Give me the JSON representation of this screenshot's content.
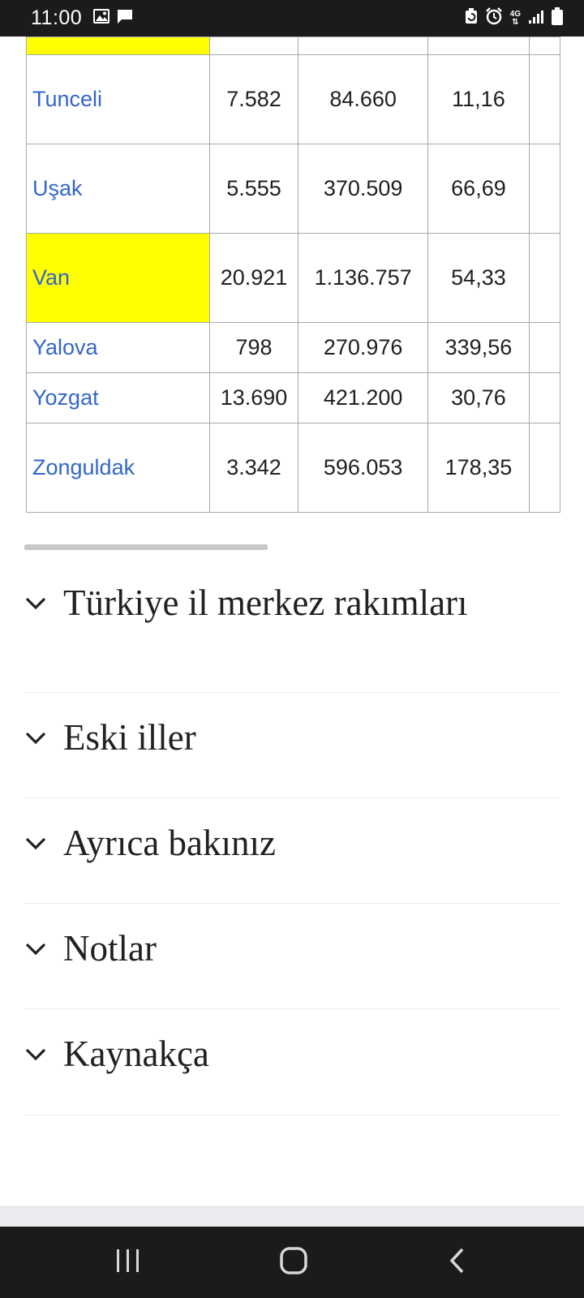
{
  "status_bar": {
    "time": "11:00",
    "network": "4G",
    "icons": [
      "image-icon",
      "message-icon",
      "battery-saver-icon",
      "alarm-icon",
      "network-4g-icon",
      "signal-icon",
      "battery-icon"
    ]
  },
  "table": {
    "rows": [
      {
        "name": "",
        "area": "",
        "population": "",
        "density": "",
        "highlight": true,
        "partial": true
      },
      {
        "name": "Tunceli",
        "area": "7.582",
        "population": "84.660",
        "density": "11,16",
        "highlight": false
      },
      {
        "name": "Uşak",
        "area": "5.555",
        "population": "370.509",
        "density": "66,69",
        "highlight": false
      },
      {
        "name": "Van",
        "area": "20.921",
        "population": "1.136.757",
        "density": "54,33",
        "highlight": true
      },
      {
        "name": "Yalova",
        "area": "798",
        "population": "270.976",
        "density": "339,56",
        "highlight": false
      },
      {
        "name": "Yozgat",
        "area": "13.690",
        "population": "421.200",
        "density": "30,76",
        "highlight": false
      },
      {
        "name": "Zonguldak",
        "area": "3.342",
        "population": "596.053",
        "density": "178,35",
        "highlight": false
      }
    ]
  },
  "sections": [
    {
      "title": "Türkiye il merkez rakımları"
    },
    {
      "title": "Eski iller"
    },
    {
      "title": "Ayrıca bakınız"
    },
    {
      "title": "Notlar"
    },
    {
      "title": "Kaynakça"
    }
  ],
  "nav_bar": {
    "icons": [
      "recents-icon",
      "home-icon",
      "back-icon"
    ]
  },
  "colors": {
    "link": "#3366cc",
    "highlight": "#ffff00",
    "border": "#a2a9b1",
    "bar": "#1b1b1b"
  }
}
